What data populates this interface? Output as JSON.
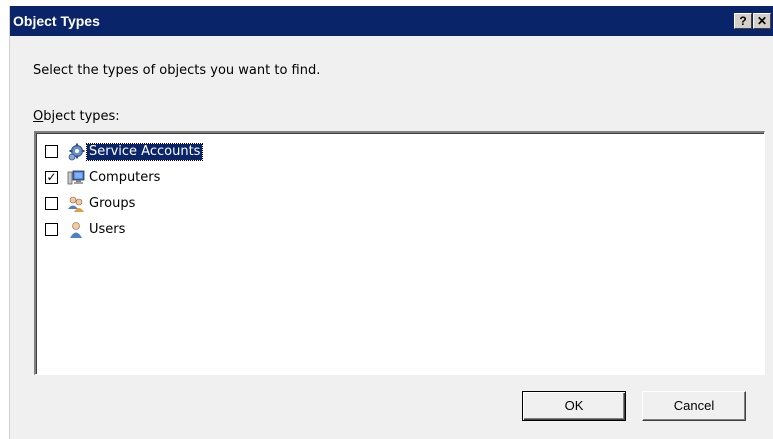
{
  "window": {
    "title": "Object Types",
    "help_label": "?",
    "close_label": "✕"
  },
  "instruction": "Select the types of objects you want to find.",
  "list": {
    "label_mnemonic": "O",
    "label_rest": "bject types:",
    "items": [
      {
        "label": "Service Accounts",
        "checked": false,
        "selected": true,
        "icon": "service-accounts-icon"
      },
      {
        "label": "Computers",
        "checked": true,
        "selected": false,
        "icon": "computer-icon"
      },
      {
        "label": "Groups",
        "checked": false,
        "selected": false,
        "icon": "groups-icon"
      },
      {
        "label": "Users",
        "checked": false,
        "selected": false,
        "icon": "user-icon"
      }
    ]
  },
  "buttons": {
    "ok": "OK",
    "cancel": "Cancel"
  },
  "colors": {
    "titlebar": "#0a246a",
    "selection": "#0a246a",
    "dialog_bg": "#f0f0f0"
  }
}
